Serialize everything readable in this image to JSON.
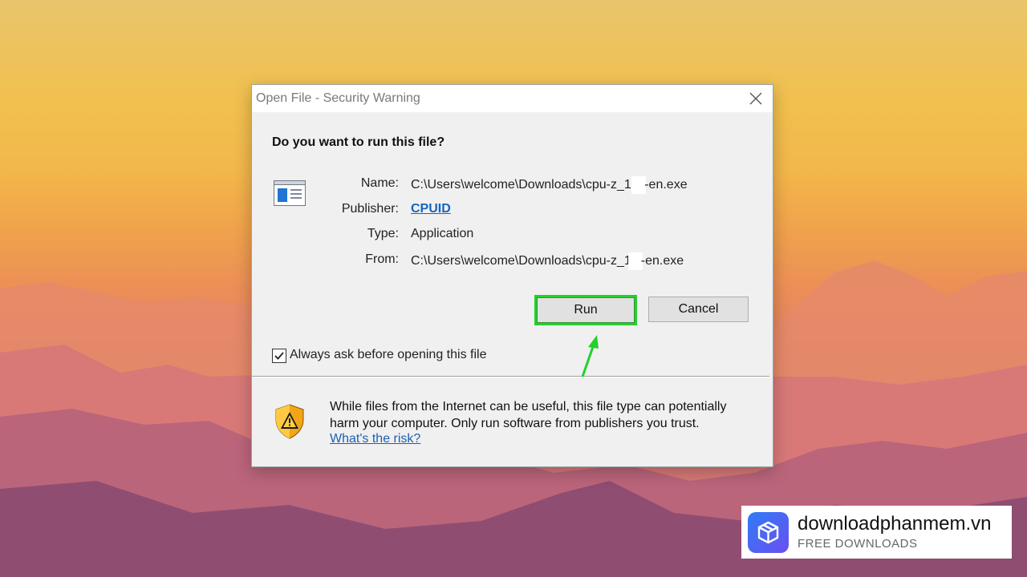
{
  "dialog": {
    "title": "Open File - Security Warning",
    "question": "Do you want to run this file?",
    "fields": [
      {
        "label": "Name:",
        "value_start": "C:\\Users\\welcome\\Downloads\\cpu-z_1.",
        "value_end": "-en.exe"
      },
      {
        "label": "Publisher:",
        "value": "CPUID"
      },
      {
        "label": "Type:",
        "value": "Application"
      },
      {
        "label": "From:",
        "value_start": "C:\\Users\\welcome\\Downloads\\cpu-z_1",
        "value_end": "-en.exe"
      }
    ],
    "run_label": "Run",
    "cancel_label": "Cancel",
    "checkbox_label": "Always ask before opening this file",
    "checkbox_checked": true,
    "warning_text": "While files from the Internet can be useful, this file type can potentially harm your computer. Only run software from publishers you trust.",
    "risk_link": "What's the risk?"
  },
  "watermark": {
    "name": "downloadphanmem.vn",
    "tagline": "FREE DOWNLOADS"
  },
  "colors": {
    "highlight": "#22d12c",
    "link": "#1a5fb4"
  }
}
